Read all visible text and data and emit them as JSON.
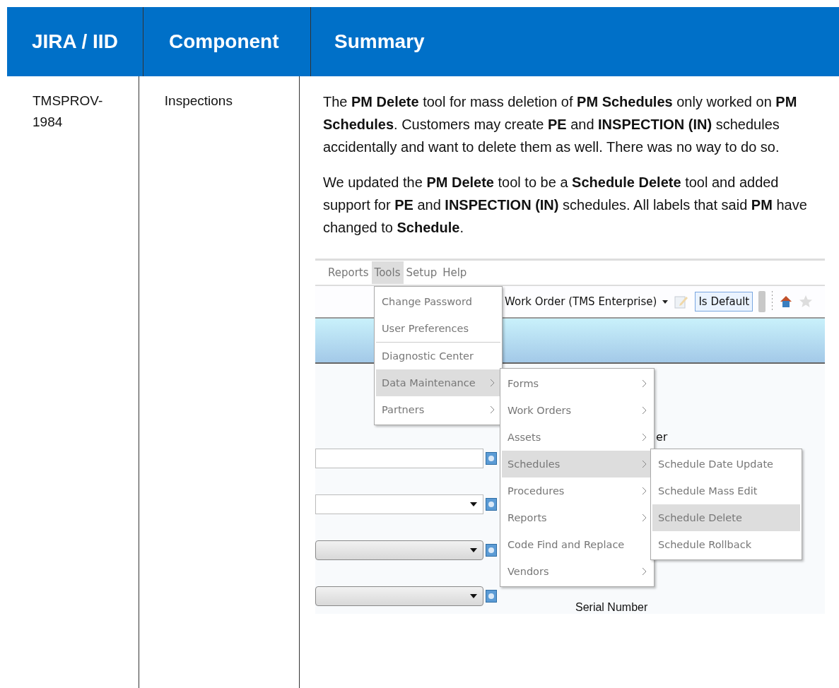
{
  "table": {
    "columns": [
      "JIRA / IID",
      "Component",
      "Summary"
    ],
    "rows": [
      {
        "jira_iid": "TMSPROV-1984",
        "component": "Inspections",
        "paragraphs": [
          "The **PM Delete** tool for mass deletion of **PM Schedules** only worked on **PM Schedules**.  Customers may create **PE** and **INSPECTION (IN)** schedules accidentally and want to delete them as well.  There was no way to do so.",
          "We updated the **PM Delete** tool to be a **Schedule Delete** tool and added support for **PE** and **INSPECTION (IN)** schedules.  All labels that said **PM** have changed to **Schedule**."
        ],
        "screenshot": {
          "menubar": [
            {
              "label": "Reports",
              "selected": false
            },
            {
              "label": "Tools",
              "selected": true
            },
            {
              "label": "Setup",
              "selected": false
            },
            {
              "label": "Help",
              "selected": false
            }
          ],
          "view_selector": "Work Order (TMS Enterprise)",
          "default_toggle": "Is Default",
          "fields": [
            {
              "kind": "text"
            },
            {
              "kind": "dropdown"
            },
            {
              "kind": "combo"
            },
            {
              "kind": "combo"
            }
          ],
          "labels": [
            "er",
            "Serial Number"
          ],
          "tools_menu": [
            {
              "label": "Change Password",
              "selected": false,
              "submenu": false,
              "separator": false
            },
            {
              "label": "User Preferences",
              "selected": false,
              "submenu": false,
              "separator": false
            },
            {
              "label": "Diagnostic Center",
              "selected": false,
              "submenu": false,
              "separator": true
            },
            {
              "label": "Data Maintenance",
              "selected": true,
              "submenu": true,
              "separator": false
            },
            {
              "label": "Partners",
              "selected": false,
              "submenu": true,
              "separator": false
            }
          ],
          "data_menu": [
            {
              "label": "Forms",
              "selected": false,
              "submenu": true
            },
            {
              "label": "Work Orders",
              "selected": false,
              "submenu": true
            },
            {
              "label": "Assets",
              "selected": false,
              "submenu": true
            },
            {
              "label": "Schedules",
              "selected": true,
              "submenu": true
            },
            {
              "label": "Procedures",
              "selected": false,
              "submenu": true
            },
            {
              "label": "Reports",
              "selected": false,
              "submenu": true
            },
            {
              "label": "Code Find and Replace",
              "selected": false,
              "submenu": false
            },
            {
              "label": "Vendors",
              "selected": false,
              "submenu": true
            }
          ],
          "schedules_menu": [
            {
              "label": "Schedule Date Update",
              "selected": false
            },
            {
              "label": "Schedule Mass Edit",
              "selected": false
            },
            {
              "label": "Schedule Delete",
              "selected": true
            },
            {
              "label": "Schedule Rollback",
              "selected": false
            }
          ]
        }
      }
    ]
  }
}
